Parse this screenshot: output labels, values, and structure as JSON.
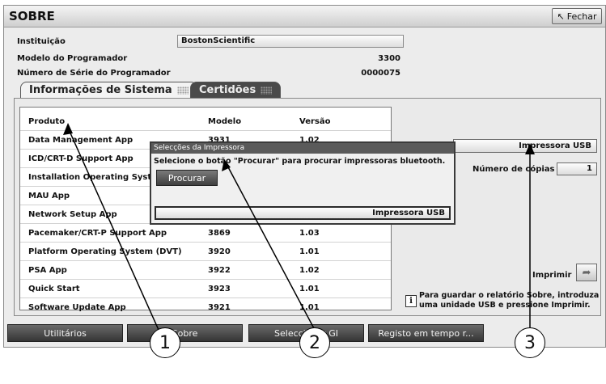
{
  "window": {
    "title": "SOBRE",
    "close_label": "Fechar",
    "close_icon": "cursor-arrow-icon"
  },
  "info": {
    "institution_label": "Instituição",
    "institution_value": "BostonScientific",
    "model_label": "Modelo do Programador",
    "model_value": "3300",
    "serial_label": "Número de Série do Programador",
    "serial_value": "0000075"
  },
  "tabs": [
    {
      "label": "Informações de Sistema"
    },
    {
      "label": "Certidões"
    }
  ],
  "table": {
    "headers": [
      "Produto",
      "Modelo",
      "Versão"
    ],
    "rows": [
      [
        "Data Management App",
        "3931",
        "1.02"
      ],
      [
        "ICD/CRT-D Support App",
        "",
        ""
      ],
      [
        "Installation Operating Syste",
        "",
        ""
      ],
      [
        "MAU App",
        "",
        ""
      ],
      [
        "Network Setup App",
        "",
        ""
      ],
      [
        "Pacemaker/CRT-P Support App",
        "3869",
        "1.03"
      ],
      [
        "Platform Operating System (DVT)",
        "3920",
        "1.01"
      ],
      [
        "PSA App",
        "3922",
        "1.02"
      ],
      [
        "Quick Start",
        "3923",
        "1.01"
      ],
      [
        "Software Update App",
        "3921",
        "1.01"
      ]
    ]
  },
  "right": {
    "printer_select": "Impressora USB",
    "copies_label": "Número de cópias",
    "copies_value": "1",
    "print_label": "Imprimir",
    "hint": "Para guardar o relatório Sobre, introduza uma unidade USB e pressione Imprimir."
  },
  "dialog": {
    "title": "Selecções da Impressora",
    "message": "Selecione o botão \"Procurar\" para procurar impressoras bluetooth.",
    "find_label": "Procurar",
    "printer_value": "Impressora USB"
  },
  "nav": [
    "Utilitários",
    "Sobre",
    "Seleccionar GI",
    "Registo em tempo r..."
  ],
  "annotations": [
    "1",
    "2",
    "3"
  ]
}
